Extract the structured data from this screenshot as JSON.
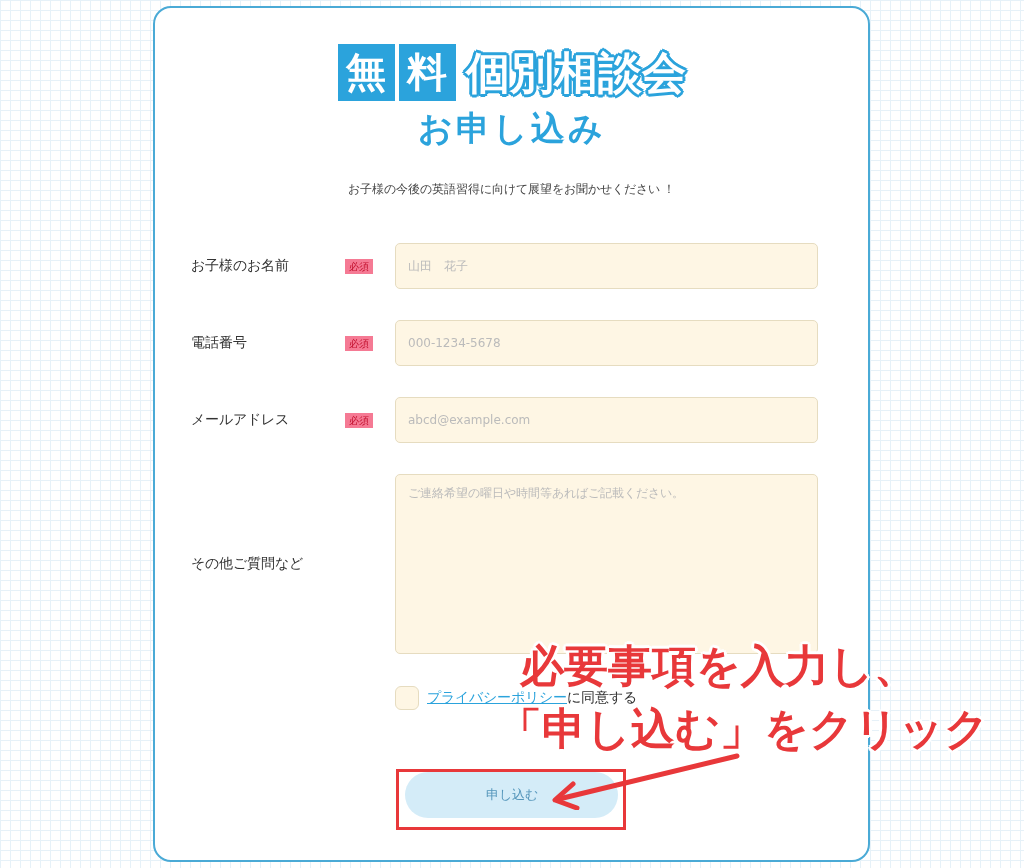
{
  "logo": {
    "boxed": [
      "無",
      "料"
    ],
    "outlined": "個別相談会",
    "subtitle": "お申し込み"
  },
  "intro": "お子様の今後の英語習得に向けて展望をお聞かせください ！",
  "fields": [
    {
      "kind": "input",
      "label": "お子様のお名前",
      "badge": "必須",
      "placeholder": "山田　花子"
    },
    {
      "kind": "input",
      "label": "電話番号",
      "badge": "必須",
      "placeholder": "000-1234-5678"
    },
    {
      "kind": "input",
      "label": "メールアドレス",
      "badge": "必須",
      "placeholder": "abcd@example.com"
    },
    {
      "kind": "textarea",
      "label": "その他ご質問など",
      "placeholder": "ご連絡希望の曜日や時間等あればご記載ください。"
    }
  ],
  "privacy": {
    "checked": false,
    "link": "プライバシーポリシー",
    "text": "に同意する"
  },
  "submit": {
    "label": "申し込む",
    "disabled": true
  },
  "annotation": {
    "lines": [
      "必要事項を入力し、",
      "「申し込む」をクリック"
    ]
  }
}
